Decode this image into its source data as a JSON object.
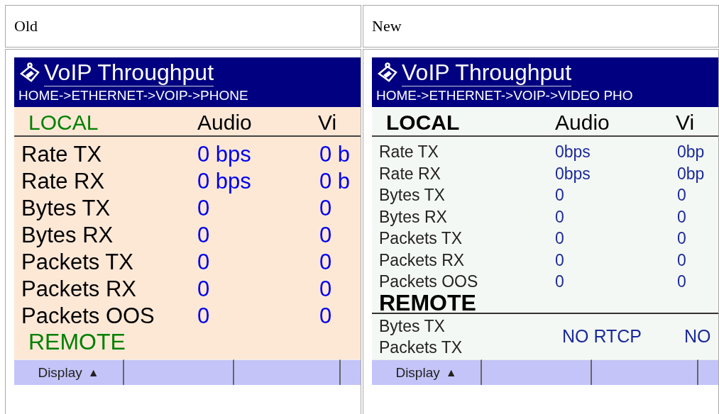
{
  "table": {
    "columns": [
      {
        "heading": "Old",
        "screen": {
          "kind": "old",
          "title": "VoIP Throughput",
          "breadcrumb": "HOME->ETHERNET->VOIP->PHONE",
          "section": "LOCAL",
          "columns": [
            "Audio",
            "Vi"
          ],
          "rows": [
            {
              "label": "Rate TX",
              "values": [
                "0 bps",
                "0 b"
              ]
            },
            {
              "label": "Rate RX",
              "values": [
                "0 bps",
                "0 b"
              ]
            },
            {
              "label": "Bytes TX",
              "values": [
                "0",
                "0"
              ]
            },
            {
              "label": "Bytes RX",
              "values": [
                "0",
                "0"
              ]
            },
            {
              "label": "Packets TX",
              "values": [
                "0",
                "0"
              ]
            },
            {
              "label": "Packets RX",
              "values": [
                "0",
                "0"
              ]
            },
            {
              "label": "Packets OOS",
              "values": [
                "0",
                "0"
              ]
            }
          ],
          "remote": {
            "label": "REMOTE"
          },
          "softkeys": [
            {
              "label": "Display",
              "arrow": "▲"
            }
          ]
        }
      },
      {
        "heading": "New",
        "screen": {
          "kind": "new",
          "title": "VoIP Throughput",
          "breadcrumb": "HOME->ETHERNET->VOIP->VIDEO PHO",
          "section": "LOCAL",
          "columns": [
            "Audio",
            "Vi"
          ],
          "rows": [
            {
              "label": "Rate TX",
              "values": [
                "0bps",
                "0bp"
              ]
            },
            {
              "label": "Rate RX",
              "values": [
                "0bps",
                "0bp"
              ]
            },
            {
              "label": "Bytes TX",
              "values": [
                "0",
                "0"
              ]
            },
            {
              "label": "Bytes RX",
              "values": [
                "0",
                "0"
              ]
            },
            {
              "label": "Packets TX",
              "values": [
                "0",
                "0"
              ]
            },
            {
              "label": "Packets RX",
              "values": [
                "0",
                "0"
              ]
            },
            {
              "label": "Packets OOS",
              "values": [
                "0",
                "0"
              ]
            }
          ],
          "remote": {
            "label": "REMOTE",
            "labels": [
              "Bytes TX",
              "Packets TX"
            ],
            "values": [
              "NO RTCP",
              "NO"
            ]
          },
          "softkeys": [
            {
              "label": "Display",
              "arrow": "▲"
            }
          ]
        }
      }
    ]
  }
}
